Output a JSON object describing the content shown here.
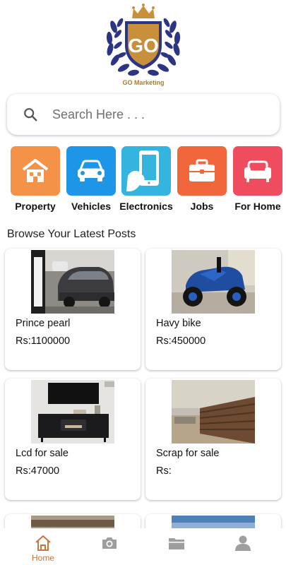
{
  "brand": {
    "name": "GO Marketing",
    "monogram": "GO"
  },
  "search": {
    "placeholder": "Search Here . . ."
  },
  "categories": [
    {
      "label": "Property",
      "color": "#f5924a",
      "icon": "house-icon"
    },
    {
      "label": "Vehicles",
      "color": "#1e96e8",
      "icon": "car-icon"
    },
    {
      "label": "Electronics",
      "color": "#35b4e0",
      "icon": "phone-icon"
    },
    {
      "label": "Jobs",
      "color": "#f2663c",
      "icon": "briefcase-icon"
    },
    {
      "label": "For Home",
      "color": "#ef4c60",
      "icon": "sofa-icon"
    }
  ],
  "section_title": "Browse Your Latest Posts",
  "posts": [
    {
      "title": "Prince pearl",
      "price": "Rs:1100000"
    },
    {
      "title": "Havy bike",
      "price": "Rs:450000"
    },
    {
      "title": "Lcd for sale",
      "price": "Rs:47000"
    },
    {
      "title": "Scrap for sale",
      "price": "Rs:"
    }
  ],
  "nav": [
    {
      "label": "Home",
      "icon": "home-icon",
      "active": true
    },
    {
      "label": "",
      "icon": "camera-icon"
    },
    {
      "label": "",
      "icon": "folder-icon"
    },
    {
      "label": "",
      "icon": "profile-icon"
    }
  ],
  "colors": {
    "accent": "#c8763b",
    "nav_inactive": "#9e9e9e",
    "logo_navy": "#2b3584",
    "logo_gold": "#c9903c"
  }
}
